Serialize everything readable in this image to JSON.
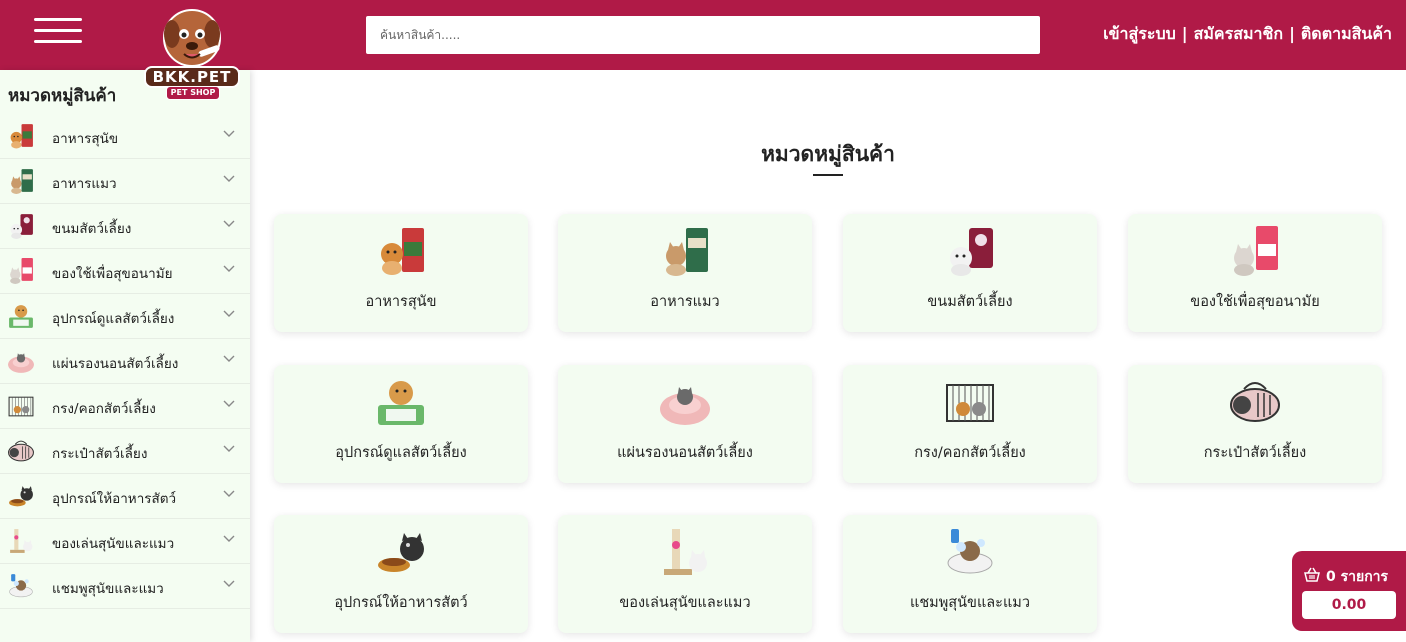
{
  "header": {
    "search_placeholder": "ค้นหาสินค้า.....",
    "login": "เข้าสู่ระบบ",
    "register": "สมัครสมาชิก",
    "track": "ติดตามสินค้า",
    "separator": "|",
    "logo_text": "BKK.PET",
    "logo_sub": "PET SHOP"
  },
  "sidebar": {
    "title": "หมวดหมู่สินค้า",
    "items": [
      {
        "label": "อาหารสุนัข",
        "icon": "dog-food-icon"
      },
      {
        "label": "อาหารแมว",
        "icon": "cat-food-icon"
      },
      {
        "label": "ขนมสัตว์เลี้ยง",
        "icon": "pet-treat-icon"
      },
      {
        "label": "ของใช้เพื่อสุขอนามัย",
        "icon": "hygiene-icon"
      },
      {
        "label": "อุปกรณ์ดูแลสัตว์เลี้ยง",
        "icon": "pet-care-icon"
      },
      {
        "label": "แผ่นรองนอนสัตว์เลี้ยง",
        "icon": "pet-bed-icon"
      },
      {
        "label": "กรง/คอกสัตว์เลี้ยง",
        "icon": "pet-cage-icon"
      },
      {
        "label": "กระเป๋าสัตว์เลี้ยง",
        "icon": "pet-carrier-icon"
      },
      {
        "label": "อุปกรณ์ให้อาหารสัตว์",
        "icon": "feeder-icon"
      },
      {
        "label": "ของเล่นสุนัขและแมว",
        "icon": "pet-toy-icon"
      },
      {
        "label": "แชมพูสุนัขและแมว",
        "icon": "shampoo-icon"
      }
    ]
  },
  "main": {
    "title": "หมวดหมู่สินค้า",
    "categories": [
      {
        "label": "อาหารสุนัข"
      },
      {
        "label": "อาหารแมว"
      },
      {
        "label": "ขนมสัตว์เลี้ยง"
      },
      {
        "label": "ของใช้เพื่อสุขอนามัย"
      },
      {
        "label": "อุปกรณ์ดูแลสัตว์เลี้ยง"
      },
      {
        "label": "แผ่นรองนอนสัตว์เลี้ยง"
      },
      {
        "label": "กรง/คอกสัตว์เลี้ยง"
      },
      {
        "label": "กระเป๋าสัตว์เลี้ยง"
      },
      {
        "label": "อุปกรณ์ให้อาหารสัตว์"
      },
      {
        "label": "ของเล่นสุนัขและแมว"
      },
      {
        "label": "แชมพูสุนัขและแมว"
      }
    ]
  },
  "cart": {
    "count_label": "0 รายการ",
    "total": "0.00"
  },
  "colors": {
    "brand": "#b01a47",
    "card_bg": "#f3fcf1",
    "sidebar_bg": "#f4fdf2"
  }
}
